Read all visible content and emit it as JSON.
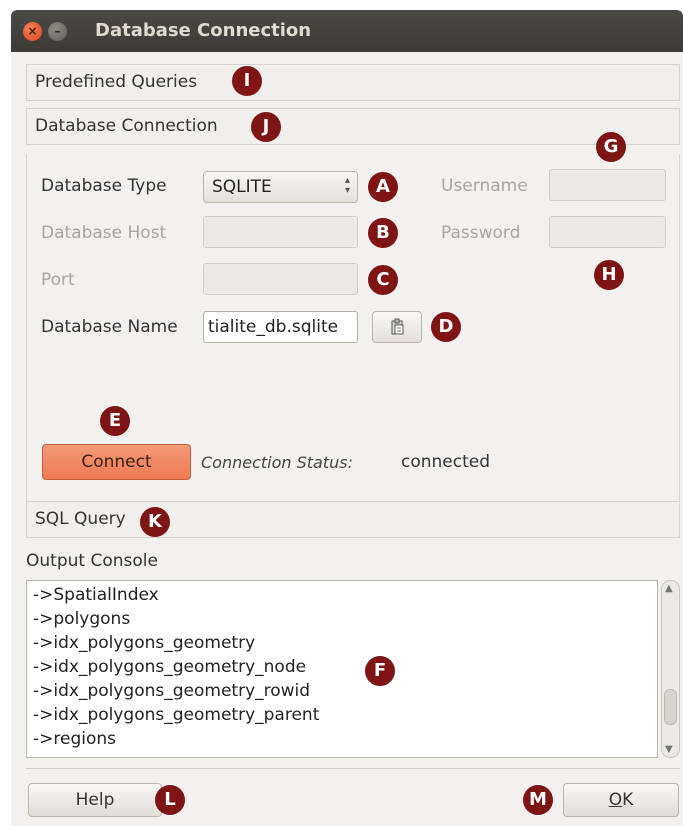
{
  "window": {
    "title": "Database Connection",
    "close_glyph": "×",
    "min_glyph": "–"
  },
  "panels": {
    "predefined_queries": "Predefined Queries",
    "database_connection": "Database Connection",
    "sql_query": "SQL Query"
  },
  "connection": {
    "database_type_label": "Database Type",
    "database_type_value": "SQLITE",
    "database_host_label": "Database Host",
    "database_host_value": "",
    "port_label": "Port",
    "port_value": "",
    "database_name_label": "Database Name",
    "database_name_value": "tialite_db.sqlite",
    "username_label": "Username",
    "username_value": "",
    "password_label": "Password",
    "password_value": "",
    "browse_icon": "paste-icon",
    "connect_label": "Connect",
    "status_label": "Connection Status:",
    "status_value": "connected"
  },
  "console": {
    "label": "Output Console",
    "lines": [
      "->SpatialIndex",
      "->polygons",
      "->idx_polygons_geometry",
      "->idx_polygons_geometry_node",
      "->idx_polygons_geometry_rowid",
      "->idx_polygons_geometry_parent",
      "->regions"
    ]
  },
  "footer": {
    "help_label": "Help",
    "ok_mnemonic": "O",
    "ok_rest": "K"
  },
  "markers": {
    "A": "A",
    "B": "B",
    "C": "C",
    "D": "D",
    "E": "E",
    "F": "F",
    "G": "G",
    "H": "H",
    "I": "I",
    "J": "J",
    "K": "K",
    "L": "L",
    "M": "M"
  },
  "colors": {
    "marker": "#7e1414",
    "connect_button": "#f08a62",
    "titlebar": "#3c3b37"
  }
}
